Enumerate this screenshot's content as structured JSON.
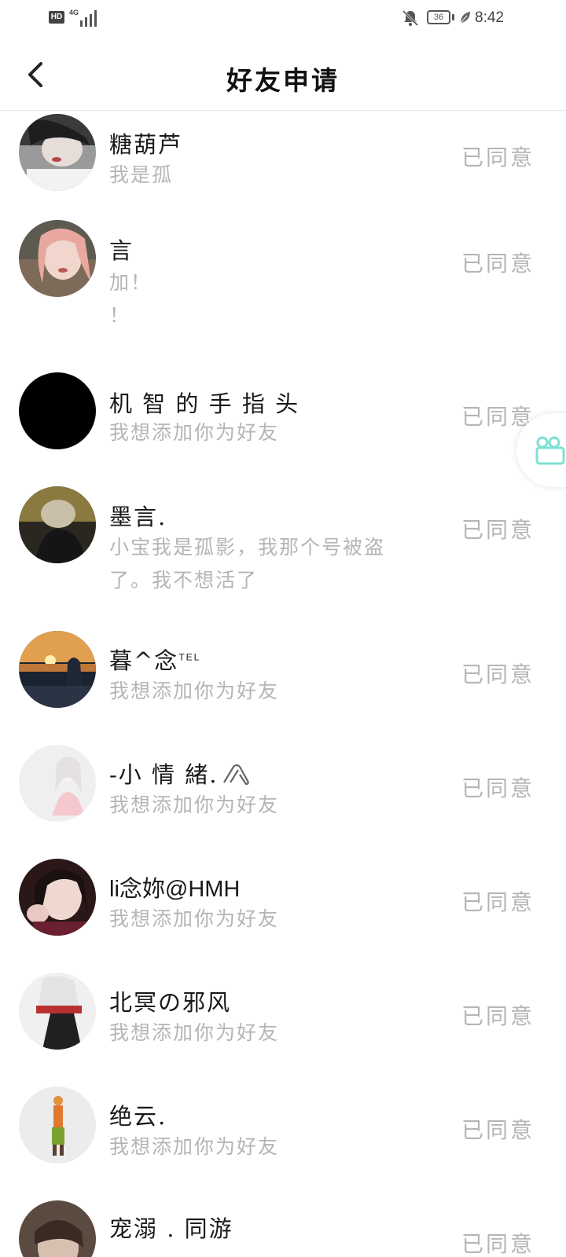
{
  "status_bar": {
    "hd_label": "HD",
    "network_label": "4G",
    "battery_level": "36",
    "time": "8:42"
  },
  "header": {
    "title": "好友申请",
    "back_icon": "chevron-left-icon"
  },
  "requests": [
    {
      "name": "糖葫芦",
      "message": "我是孤",
      "status": "已同意"
    },
    {
      "name": "言",
      "message": "加！\n！",
      "status": "已同意"
    },
    {
      "name": "机 智 的 手 指 头",
      "message": "我想添加你为好友",
      "status": "已同意"
    },
    {
      "name": "墨言.",
      "message": "小宝我是孤影，我那个号被盗\n了。我不想活了",
      "status": "已同意"
    },
    {
      "name": "暮^念",
      "name_suffix": "TEL",
      "message": "我想添加你为好友",
      "status": "已同意"
    },
    {
      "name": "-小 情 緒.",
      "message": "我想添加你为好友",
      "status": "已同意"
    },
    {
      "name": "li念妳@HMH",
      "message": "我想添加你为好友",
      "status": "已同意"
    },
    {
      "name": "北冥の邪风",
      "message": "我想添加你为好友",
      "status": "已同意"
    },
    {
      "name": "绝云.",
      "message": "我想添加你为好友",
      "status": "已同意"
    },
    {
      "name": "宠溺 . 同游",
      "message": "",
      "status": "已同意"
    }
  ]
}
